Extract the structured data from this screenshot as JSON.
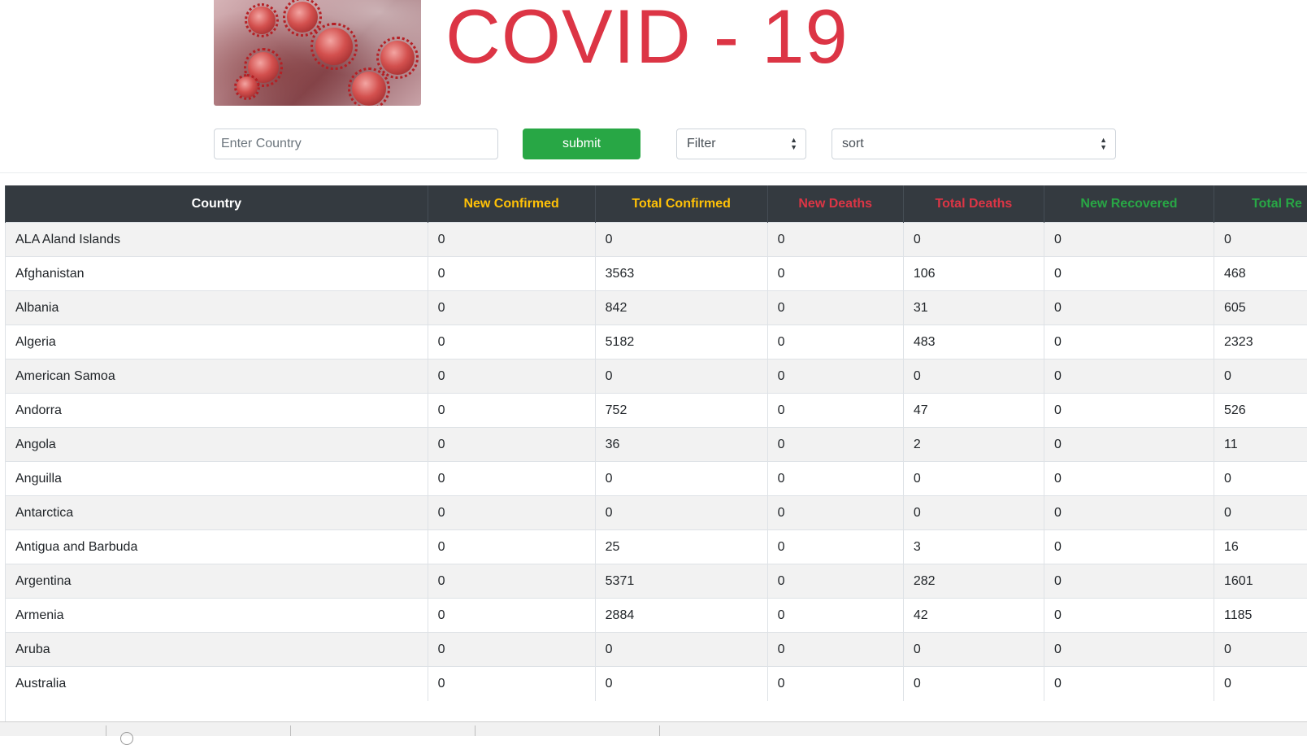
{
  "header": {
    "title": "COVID - 19",
    "image_alt": "coronavirus-image"
  },
  "controls": {
    "search_placeholder": "Enter Country",
    "submit_label": "submit",
    "filter_label": "Filter",
    "sort_label": "sort"
  },
  "colors": {
    "title": "#dc3545",
    "confirmed": "#ffc107",
    "deaths": "#dc3545",
    "recovered": "#28a745",
    "header_bg": "#343a40",
    "submit_bg": "#28a745"
  },
  "table": {
    "columns": [
      {
        "label": "Country",
        "color": "#ffffff"
      },
      {
        "label": "New Confirmed",
        "color": "#ffc107"
      },
      {
        "label": "Total Confirmed",
        "color": "#ffc107"
      },
      {
        "label": "New Deaths",
        "color": "#dc3545"
      },
      {
        "label": "Total Deaths",
        "color": "#dc3545"
      },
      {
        "label": "New Recovered",
        "color": "#28a745"
      },
      {
        "label": "Total Re",
        "color": "#28a745"
      }
    ],
    "rows": [
      [
        "ALA Aland Islands",
        "0",
        "0",
        "0",
        "0",
        "0",
        "0"
      ],
      [
        "Afghanistan",
        "0",
        "3563",
        "0",
        "106",
        "0",
        "468"
      ],
      [
        "Albania",
        "0",
        "842",
        "0",
        "31",
        "0",
        "605"
      ],
      [
        "Algeria",
        "0",
        "5182",
        "0",
        "483",
        "0",
        "2323"
      ],
      [
        "American Samoa",
        "0",
        "0",
        "0",
        "0",
        "0",
        "0"
      ],
      [
        "Andorra",
        "0",
        "752",
        "0",
        "47",
        "0",
        "526"
      ],
      [
        "Angola",
        "0",
        "36",
        "0",
        "2",
        "0",
        "11"
      ],
      [
        "Anguilla",
        "0",
        "0",
        "0",
        "0",
        "0",
        "0"
      ],
      [
        "Antarctica",
        "0",
        "0",
        "0",
        "0",
        "0",
        "0"
      ],
      [
        "Antigua and Barbuda",
        "0",
        "25",
        "0",
        "3",
        "0",
        "16"
      ],
      [
        "Argentina",
        "0",
        "5371",
        "0",
        "282",
        "0",
        "1601"
      ],
      [
        "Armenia",
        "0",
        "2884",
        "0",
        "42",
        "0",
        "1185"
      ],
      [
        "Aruba",
        "0",
        "0",
        "0",
        "0",
        "0",
        "0"
      ],
      [
        "Australia",
        "0",
        "0",
        "0",
        "0",
        "0",
        "0"
      ]
    ]
  }
}
